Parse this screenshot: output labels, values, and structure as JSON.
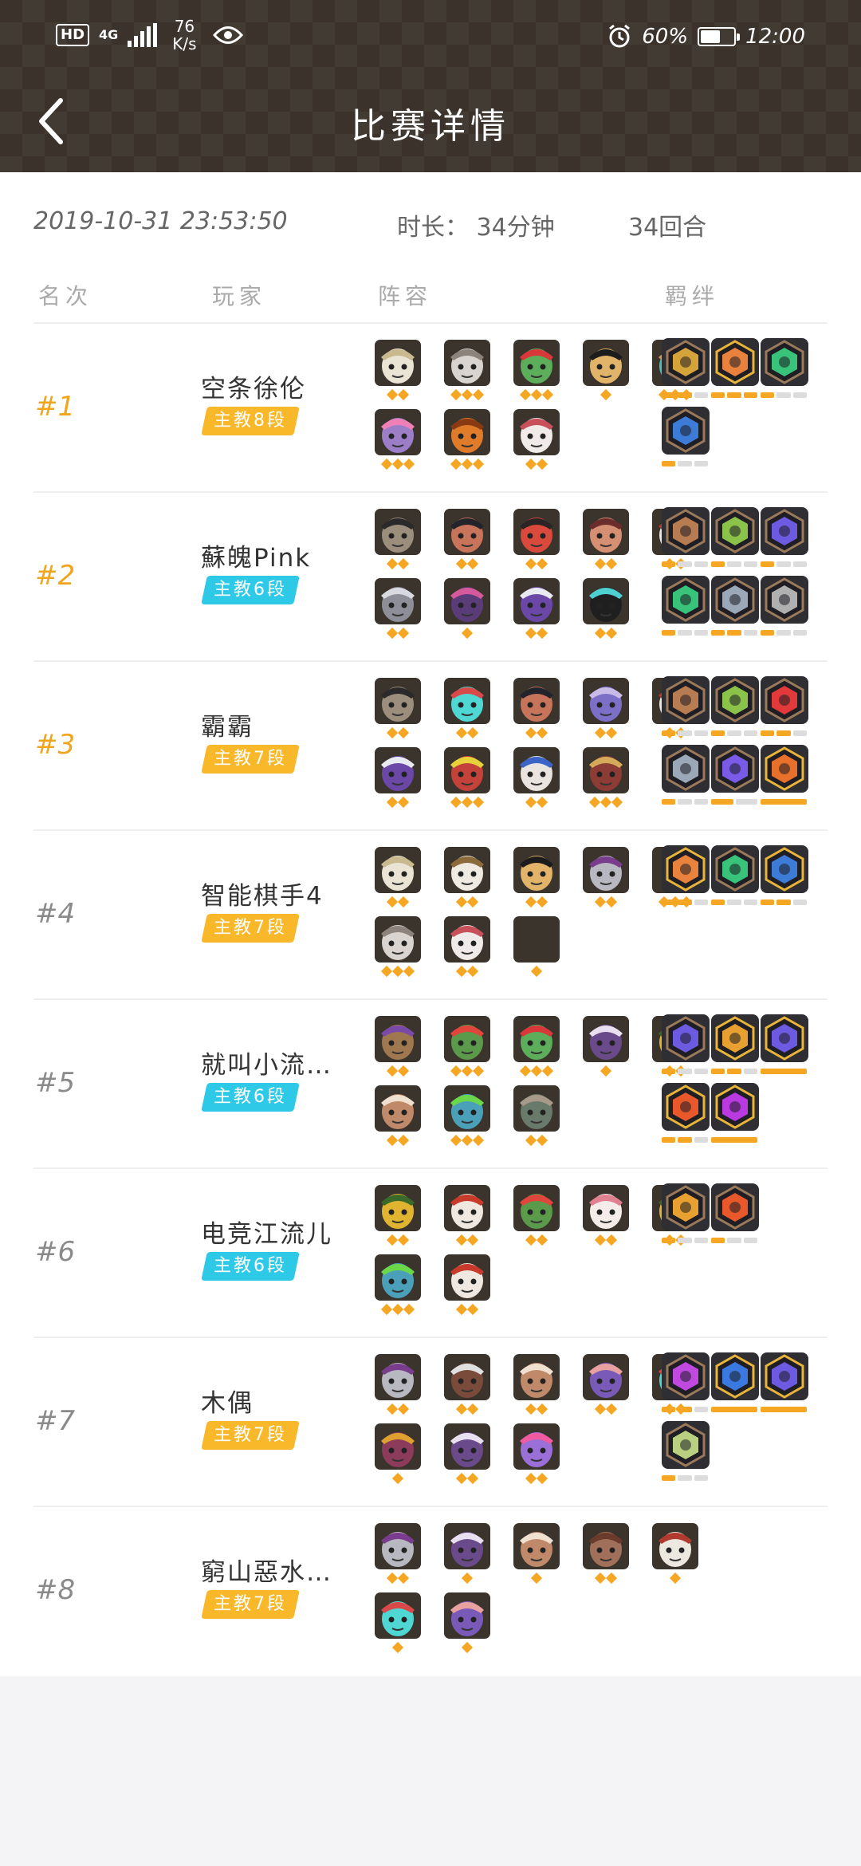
{
  "status_bar": {
    "hd": "HD",
    "network": "4G",
    "speed_value": "76",
    "speed_unit": "K/s",
    "battery": "60%",
    "time": "12:00"
  },
  "header": {
    "title": "比赛详情"
  },
  "match": {
    "datetime": "2019-10-31 23:53:50",
    "duration": "时长： 34分钟",
    "rounds": "34回合"
  },
  "columns": {
    "rank": "名次",
    "player": "玩家",
    "lineup": "阵容",
    "traits": "羁绊"
  },
  "colors": {
    "gold_text": "#f0a51c",
    "gray_text": "#8a8a8a",
    "badge_gold": "#f8b82a",
    "badge_cyan": "#2dc9e6",
    "star": "#f5a623"
  },
  "players": [
    {
      "rank": "#1",
      "name": "空条徐伦",
      "badge": "主教8段",
      "badge_color": "gold",
      "champions": [
        {
          "face": "#e9e4d4",
          "accent": "#c9b98f",
          "stars": 2
        },
        {
          "face": "#d9d4cf",
          "accent": "#8c837c",
          "stars": 3
        },
        {
          "face": "#5dae5a",
          "accent": "#d8383a",
          "stars": 3
        },
        {
          "face": "#e2b46a",
          "accent": "#1c1c1c",
          "stars": 1
        },
        {
          "face": "#4fc3b6",
          "accent": "#d29b58",
          "stars": 3
        },
        {
          "face": "#9c7ec8",
          "accent": "#ef7fb7",
          "stars": 3
        },
        {
          "face": "#e07b2a",
          "accent": "#8a3a12",
          "stars": 3
        },
        {
          "face": "#f0ebe8",
          "accent": "#c8505a",
          "stars": 2
        }
      ],
      "traits": [
        {
          "color": "#d4a43a",
          "icon": "sword-icon",
          "tier": "bronze",
          "level": 2,
          "of": 3
        },
        {
          "color": "#e8823c",
          "icon": "leaf-icon",
          "tier": "gold",
          "level": 3,
          "of": 3
        },
        {
          "color": "#38c27a",
          "icon": "paw-icon",
          "tier": "bronze",
          "level": 1,
          "of": 3
        },
        {
          "color": "#3c7bd6",
          "icon": "feather-icon",
          "tier": "bronze",
          "level": 1,
          "of": 3
        }
      ]
    },
    {
      "rank": "#2",
      "name": "蘇魄Pink",
      "badge": "主教6段",
      "badge_color": "cyan",
      "champions": [
        {
          "face": "#9c8e7c",
          "accent": "#2a2a2a",
          "stars": 2
        },
        {
          "face": "#c8745a",
          "accent": "#23232b",
          "stars": 2
        },
        {
          "face": "#d94a3c",
          "accent": "#2b2424",
          "stars": 2
        },
        {
          "face": "#d58f73",
          "accent": "#6b2c2c",
          "stars": 2
        },
        {
          "face": "#ece7e0",
          "accent": "#b03a2e",
          "stars": 2
        },
        {
          "face": "#8e8e98",
          "accent": "#d9d9e1",
          "stars": 2
        },
        {
          "face": "#5a3c78",
          "accent": "#d45a9c",
          "stars": 1
        },
        {
          "face": "#6b48a8",
          "accent": "#e9e9f1",
          "stars": 2
        },
        {
          "face": "#1f1f1f",
          "accent": "#4fd0d0",
          "stars": 2
        }
      ],
      "traits": [
        {
          "color": "#b87c52",
          "icon": "axe-icon",
          "tier": "bronze",
          "level": 1,
          "of": 3
        },
        {
          "color": "#8bc34a",
          "icon": "bow-icon",
          "tier": "bronze",
          "level": 1,
          "of": 3
        },
        {
          "color": "#6c5ae0",
          "icon": "cape-icon",
          "tier": "bronze",
          "level": 1,
          "of": 3
        },
        {
          "color": "#38c27a",
          "icon": "paw-icon",
          "tier": "bronze",
          "level": 1,
          "of": 3
        },
        {
          "color": "#9aa8b8",
          "icon": "wheel-icon",
          "tier": "bronze",
          "level": 2,
          "of": 3
        },
        {
          "color": "#b0b0b0",
          "icon": "helmet-icon",
          "tier": "bronze",
          "level": 1,
          "of": 3
        }
      ]
    },
    {
      "rank": "#3",
      "name": "霸霸",
      "badge": "主教7段",
      "badge_color": "gold",
      "champions": [
        {
          "face": "#9c8e7c",
          "accent": "#2a2a2a",
          "stars": 2
        },
        {
          "face": "#4fd7d4",
          "accent": "#d84a4a",
          "stars": 2
        },
        {
          "face": "#c8745a",
          "accent": "#23232b",
          "stars": 2
        },
        {
          "face": "#7b6fc8",
          "accent": "#c9bbe8",
          "stars": 2
        },
        {
          "face": "#ece7e0",
          "accent": "#b03a2e",
          "stars": 2
        },
        {
          "face": "#6b48a8",
          "accent": "#e9e9f1",
          "stars": 2
        },
        {
          "face": "#c4423a",
          "accent": "#e8d23c",
          "stars": 3
        },
        {
          "face": "#eae4e0",
          "accent": "#3c64c8",
          "stars": 2
        },
        {
          "face": "#8c3c34",
          "accent": "#d4aa5a",
          "stars": 3
        }
      ],
      "traits": [
        {
          "color": "#b87c52",
          "icon": "axe-icon",
          "tier": "bronze",
          "level": 1,
          "of": 3
        },
        {
          "color": "#8bc34a",
          "icon": "bow-icon",
          "tier": "bronze",
          "level": 1,
          "of": 3
        },
        {
          "color": "#e23a3a",
          "icon": "arc-icon",
          "tier": "bronze",
          "level": 2,
          "of": 3
        },
        {
          "color": "#9aa8b8",
          "icon": "wheel-icon",
          "tier": "bronze",
          "level": 1,
          "of": 3
        },
        {
          "color": "#7a5be8",
          "icon": "fish-icon",
          "tier": "bronze",
          "level": 1,
          "of": 2
        },
        {
          "color": "#e8702a",
          "icon": "demon-icon",
          "tier": "gold",
          "level": 1,
          "of": 1
        }
      ]
    },
    {
      "rank": "#4",
      "name": "智能棋手4",
      "badge": "主教7段",
      "badge_color": "gold",
      "champions": [
        {
          "face": "#e9e4d4",
          "accent": "#c9b98f",
          "stars": 2
        },
        {
          "face": "#efeae2",
          "accent": "#8c6a3a",
          "stars": 2
        },
        {
          "face": "#e2b46a",
          "accent": "#1c1c1c",
          "stars": 2
        },
        {
          "face": "#b8b8c0",
          "accent": "#7a3c8c",
          "stars": 2
        },
        {
          "face": "#3b342d",
          "accent": "#3b342d",
          "stars": 3
        },
        {
          "face": "#d9d4cf",
          "accent": "#8c837c",
          "stars": 3
        },
        {
          "face": "#f0ebe8",
          "accent": "#c8505a",
          "stars": 2
        },
        {
          "face": "#3b342d",
          "accent": "#3b342d",
          "stars": 1
        }
      ],
      "traits": [
        {
          "color": "#e8823c",
          "icon": "leaf-icon",
          "tier": "gold",
          "level": 2,
          "of": 3
        },
        {
          "color": "#38c27a",
          "icon": "paw-icon",
          "tier": "bronze",
          "level": 1,
          "of": 3
        },
        {
          "color": "#3c7bd6",
          "icon": "feather-icon",
          "tier": "gold",
          "level": 2,
          "of": 3
        }
      ]
    },
    {
      "rank": "#5",
      "name": "就叫小流…",
      "badge": "主教6段",
      "badge_color": "cyan",
      "champions": [
        {
          "face": "#a07850",
          "accent": "#7a4aa8",
          "stars": 2
        },
        {
          "face": "#5a9a4a",
          "accent": "#e0463c",
          "stars": 3
        },
        {
          "face": "#5dae5a",
          "accent": "#d8383a",
          "stars": 3
        },
        {
          "face": "#6a4a8a",
          "accent": "#e8e0f0",
          "stars": 1
        },
        {
          "face": "#e0b430",
          "accent": "#3a6a2a",
          "stars": 2
        },
        {
          "face": "#c08a6a",
          "accent": "#f0e0d0",
          "stars": 2
        },
        {
          "face": "#4aa0b8",
          "accent": "#6ad84a",
          "stars": 3
        },
        {
          "face": "#6a7a6a",
          "accent": "#a89a8a",
          "stars": 2
        }
      ],
      "traits": [
        {
          "color": "#6c5ae0",
          "icon": "cape-icon",
          "tier": "bronze",
          "level": 1,
          "of": 3
        },
        {
          "color": "#e8a030",
          "icon": "gear-icon",
          "tier": "gold",
          "level": 2,
          "of": 3
        },
        {
          "color": "#6c5ae0",
          "icon": "wizard-hat-icon",
          "tier": "gold",
          "level": 1,
          "of": 1
        },
        {
          "color": "#e8582a",
          "icon": "demon-icon",
          "tier": "gold",
          "level": 2,
          "of": 3
        },
        {
          "color": "#b83ae0",
          "icon": "skull-icon",
          "tier": "gold",
          "level": 1,
          "of": 1
        }
      ]
    },
    {
      "rank": "#6",
      "name": "电竞江流儿",
      "badge": "主教6段",
      "badge_color": "cyan",
      "champions": [
        {
          "face": "#e0b430",
          "accent": "#3a6a2a",
          "stars": 2
        },
        {
          "face": "#efe8e0",
          "accent": "#c83a2a",
          "stars": 2
        },
        {
          "face": "#5a9a4a",
          "accent": "#e0463c",
          "stars": 2
        },
        {
          "face": "#f4ece8",
          "accent": "#e08090",
          "stars": 2
        },
        {
          "face": "#e0b430",
          "accent": "#3a6a2a",
          "stars": 2
        },
        {
          "face": "#4aa0b8",
          "accent": "#6ad84a",
          "stars": 3
        },
        {
          "face": "#efe8e0",
          "accent": "#c83a2a",
          "stars": 2
        }
      ],
      "traits": [
        {
          "color": "#e8a030",
          "icon": "gear-icon",
          "tier": "bronze",
          "level": 1,
          "of": 3
        },
        {
          "color": "#e8582a",
          "icon": "demon-icon",
          "tier": "bronze",
          "level": 1,
          "of": 3
        }
      ]
    },
    {
      "rank": "#7",
      "name": "木偶",
      "badge": "主教7段",
      "badge_color": "gold",
      "champions": [
        {
          "face": "#b8b8c0",
          "accent": "#7a3c8c",
          "stars": 2
        },
        {
          "face": "#7a4a3a",
          "accent": "#e0e0e0",
          "stars": 2
        },
        {
          "face": "#c08a6a",
          "accent": "#f0e0d0",
          "stars": 2
        },
        {
          "face": "#7a5ab8",
          "accent": "#e8a0a0",
          "stars": 2
        },
        {
          "face": "#4fd7d4",
          "accent": "#d84a4a",
          "stars": 2
        },
        {
          "face": "#8c3c5a",
          "accent": "#e0a030",
          "stars": 1
        },
        {
          "face": "#6a4a8a",
          "accent": "#e8e0f0",
          "stars": 2
        },
        {
          "face": "#9a70d8",
          "accent": "#f05aa0",
          "stars": 2
        }
      ],
      "traits": [
        {
          "color": "#c04ae0",
          "icon": "knight-icon",
          "tier": "bronze",
          "level": 2,
          "of": 3
        },
        {
          "color": "#3a7ae0",
          "icon": "crest-icon",
          "tier": "gold",
          "level": 1,
          "of": 1
        },
        {
          "color": "#6c5ae0",
          "icon": "wizard-hat-icon",
          "tier": "gold",
          "level": 1,
          "of": 1
        },
        {
          "color": "#b8d080",
          "icon": "alien-icon",
          "tier": "bronze",
          "level": 1,
          "of": 3
        }
      ]
    },
    {
      "rank": "#8",
      "name": "窮山惡水…",
      "badge": "主教7段",
      "badge_color": "gold",
      "champions": [
        {
          "face": "#b8b8c0",
          "accent": "#7a3c8c",
          "stars": 2
        },
        {
          "face": "#6a4a8a",
          "accent": "#e8e0f0",
          "stars": 1
        },
        {
          "face": "#c08a6a",
          "accent": "#f0e0d0",
          "stars": 1
        },
        {
          "face": "#a0705a",
          "accent": "#6a3a2a",
          "stars": 2
        },
        {
          "face": "#ece7e0",
          "accent": "#b03a2e",
          "stars": 1
        },
        {
          "face": "#4fd7d4",
          "accent": "#d84a4a",
          "stars": 1
        },
        {
          "face": "#7a5ab8",
          "accent": "#e8a0a0",
          "stars": 1
        }
      ],
      "traits": []
    }
  ]
}
